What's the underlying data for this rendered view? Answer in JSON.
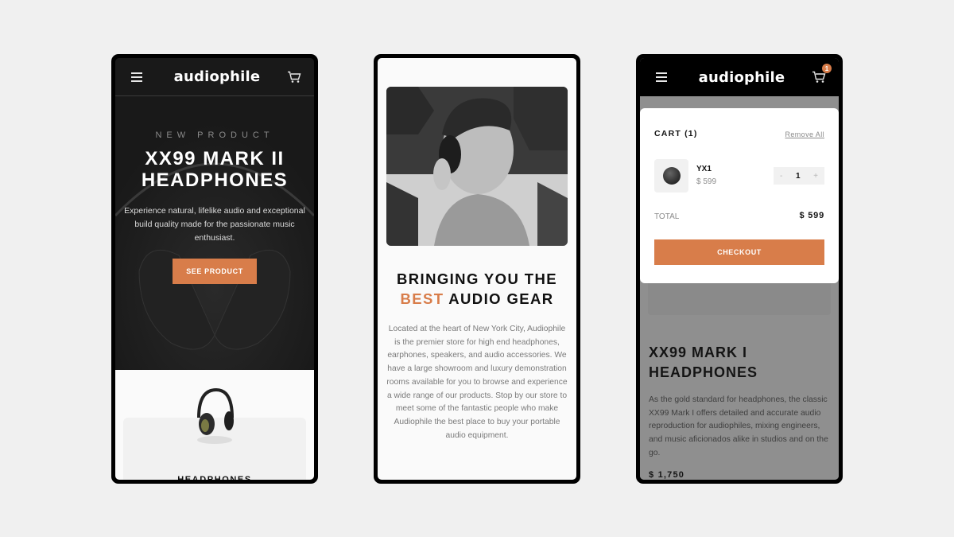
{
  "brand": {
    "logo": "audiophile",
    "accent_color": "#d87d4a"
  },
  "screens": [
    {
      "header": {
        "menu_icon": "hamburger-icon",
        "cart_icon": "cart-icon"
      },
      "hero": {
        "eyebrow": "NEW PRODUCT",
        "title_line1": "XX99 MARK II",
        "title_line2": "HEADPHONES",
        "description": "Experience natural, lifelike audio and exceptional build quality made for the passionate music enthusiast.",
        "cta_label": "SEE PRODUCT"
      },
      "category": {
        "label": "HEADPHONES"
      }
    },
    {
      "about": {
        "heading_line1": "BRINGING YOU THE",
        "heading_accent": "BEST",
        "heading_rest": " AUDIO GEAR",
        "body": "Located at the heart of New York City, Audiophile is the premier store for high end headphones, earphones, speakers, and audio accessories. We have a large showroom and luxury demonstration rooms available for you to browse and experience a wide range of our products. Stop by our store to meet some of the fantastic people who make Audiophile the best place to buy your portable audio equipment."
      }
    },
    {
      "header": {
        "menu_icon": "hamburger-icon",
        "cart_icon": "cart-icon",
        "cart_count": "1"
      },
      "cart": {
        "title": "CART (1)",
        "remove_all": "Remove All",
        "items": [
          {
            "name": "YX1",
            "price": "$ 599",
            "quantity": "1",
            "minus": "-",
            "plus": "+"
          }
        ],
        "total_label": "TOTAL",
        "total_value": "$ 599",
        "checkout_label": "CHECKOUT"
      },
      "background_product": {
        "title_line1": "XX99 MARK I",
        "title_line2": "HEADPHONES",
        "description": "As the gold standard for headphones, the classic XX99 Mark I offers detailed and accurate audio reproduction for audiophiles, mixing engineers, and music aficionados alike in studios and on the go.",
        "price": "$ 1,750"
      }
    }
  ]
}
